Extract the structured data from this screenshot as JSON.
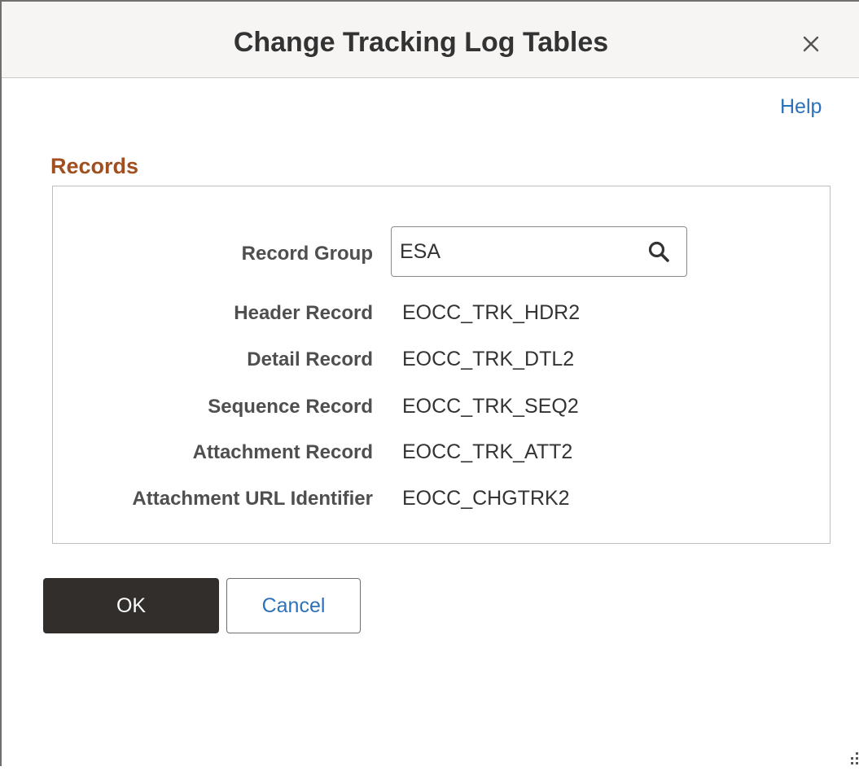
{
  "dialog": {
    "title": "Change Tracking Log Tables",
    "close_icon": "close-icon",
    "help_label": "Help"
  },
  "records": {
    "section_title": "Records",
    "record_group": {
      "label": "Record Group",
      "value": "ESA",
      "icon": "search-icon"
    },
    "fields": [
      {
        "label": "Header Record",
        "value": "EOCC_TRK_HDR2"
      },
      {
        "label": "Detail Record",
        "value": "EOCC_TRK_DTL2"
      },
      {
        "label": "Sequence Record",
        "value": "EOCC_TRK_SEQ2"
      },
      {
        "label": "Attachment Record",
        "value": "EOCC_TRK_ATT2"
      },
      {
        "label": "Attachment URL Identifier",
        "value": "EOCC_CHGTRK2"
      }
    ]
  },
  "buttons": {
    "ok_label": "OK",
    "cancel_label": "Cancel"
  },
  "colors": {
    "section_title": "#a04f21",
    "link": "#2d72b8",
    "ok_button_bg": "#322e2b",
    "title_bar_bg": "#f6f5f4"
  }
}
